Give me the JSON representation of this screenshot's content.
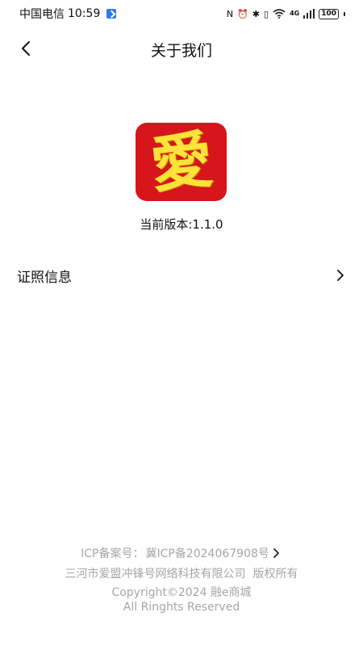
{
  "status_bar": {
    "carrier": "中国电信",
    "time": "10:59",
    "network": "4G",
    "battery": "100"
  },
  "nav": {
    "title": "关于我们"
  },
  "app": {
    "logo_char": "愛",
    "version_label": "当前版本:1.1.0"
  },
  "license": {
    "label": "证照信息"
  },
  "footer": {
    "icp_label": "ICP备案号：",
    "icp_number": "冀ICP备2024067908号",
    "company": "三河市爱盟冲锋号网络科技有限公司  版权所有",
    "copyright": "Copyright©2024 融e商城",
    "rights": "All Ringhts Reserved"
  },
  "colors": {
    "logo_bg": "#d7161c",
    "logo_fg": "#ffe23a",
    "footer_text": "#a6a6a6"
  }
}
